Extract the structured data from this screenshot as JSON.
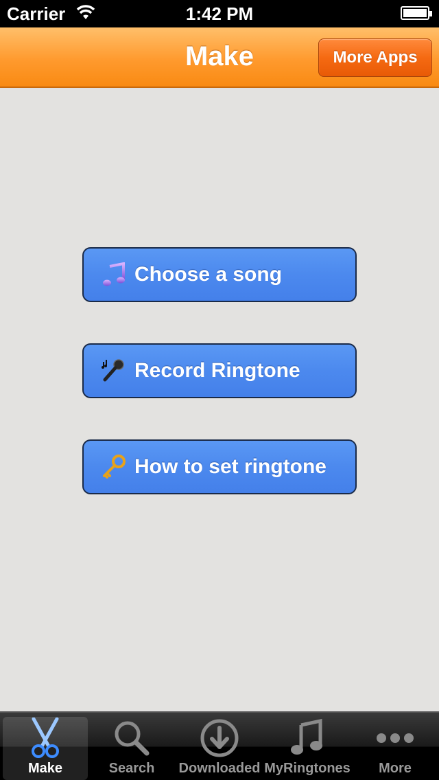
{
  "status_bar": {
    "carrier": "Carrier",
    "time": "1:42 PM"
  },
  "nav_bar": {
    "title": "Make",
    "more_apps_label": "More Apps",
    "color": "#ff9a2e"
  },
  "actions": [
    {
      "label": "Choose a song",
      "icon": "music-note-icon"
    },
    {
      "label": "Record Ringtone",
      "icon": "microphone-icon"
    },
    {
      "label": "How to set ringtone",
      "icon": "key-icon"
    }
  ],
  "button_color": "#4c89ee",
  "tab_bar": {
    "items": [
      {
        "label": "Make",
        "icon": "scissors-icon",
        "active": true
      },
      {
        "label": "Search",
        "icon": "search-icon",
        "active": false
      },
      {
        "label": "Downloaded",
        "icon": "download-icon",
        "active": false
      },
      {
        "label": "MyRingtones",
        "icon": "music-note-icon",
        "active": false
      },
      {
        "label": "More",
        "icon": "more-icon",
        "active": false
      }
    ]
  }
}
